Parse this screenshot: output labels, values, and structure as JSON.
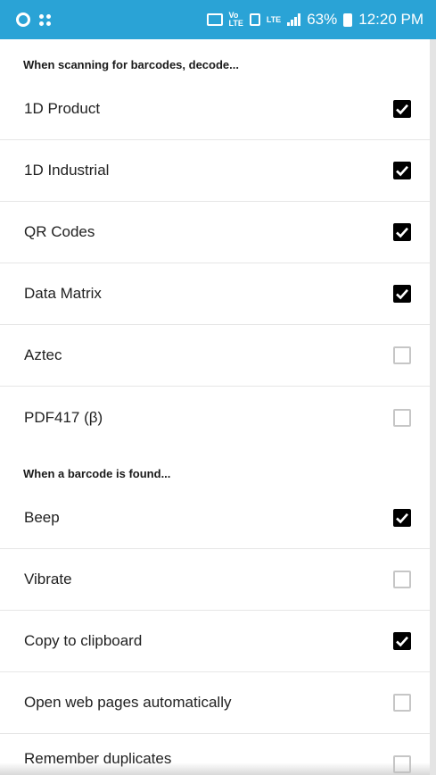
{
  "status_bar": {
    "network_label": "LTE",
    "battery_percent": "63%",
    "time": "12:20 PM",
    "icons": [
      "gear-icon",
      "grid-dots-icon",
      "cast-icon",
      "volte-icon",
      "sim-icon",
      "signal-icon",
      "battery-icon"
    ],
    "background": "#2aa3d6"
  },
  "sections": {
    "decode": {
      "header": "When scanning for barcodes, decode...",
      "items": [
        {
          "label": "1D Product",
          "checked": true
        },
        {
          "label": "1D Industrial",
          "checked": true
        },
        {
          "label": "QR Codes",
          "checked": true
        },
        {
          "label": "Data Matrix",
          "checked": true
        },
        {
          "label": "Aztec",
          "checked": false
        },
        {
          "label": "PDF417 (β)",
          "checked": false
        }
      ]
    },
    "found": {
      "header": "When a barcode is found...",
      "items": [
        {
          "label": "Beep",
          "checked": true
        },
        {
          "label": "Vibrate",
          "checked": false
        },
        {
          "label": "Copy to clipboard",
          "checked": true
        },
        {
          "label": "Open web pages automatically",
          "checked": false
        },
        {
          "label": "Remember duplicates",
          "checked": false
        }
      ]
    }
  }
}
